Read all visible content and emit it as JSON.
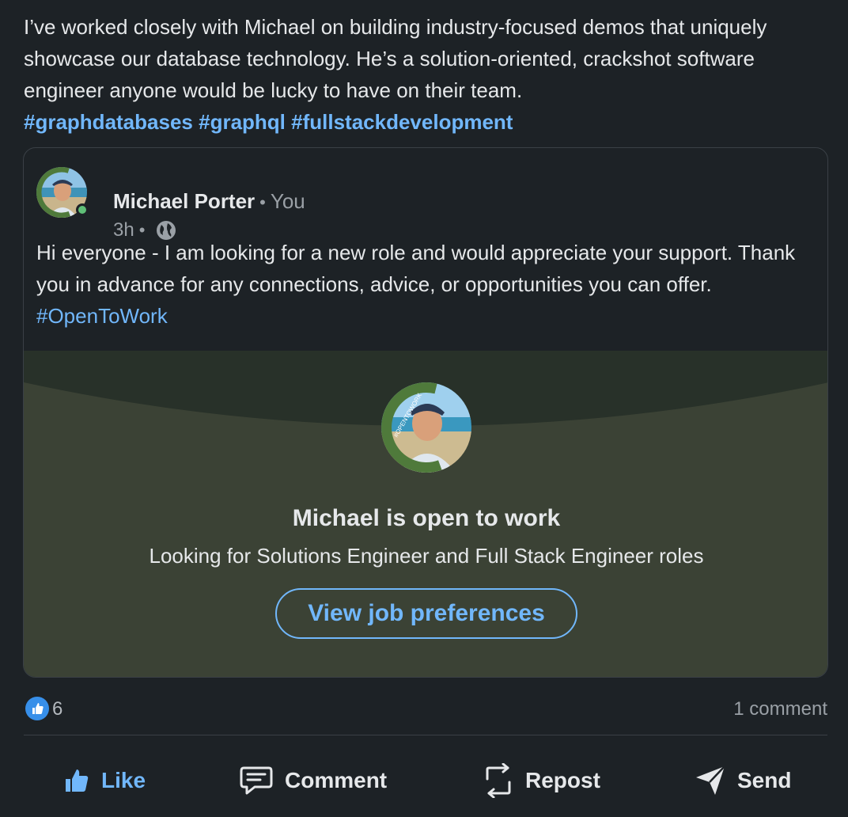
{
  "post": {
    "text": "I’ve worked closely with Michael on building industry-focused demos that uniquely showcase our database technology. He’s a solution-oriented, crackshot software engineer anyone would be lucky to have on their team.",
    "hashtags": [
      "#graphdatabases",
      "#graphql",
      "#fullstackdevelopment"
    ]
  },
  "shared": {
    "author_name": "Michael Porter",
    "relation": "You",
    "time": "3h",
    "text": "Hi everyone - I am looking for a new role and would appreciate your support. Thank you in advance for any connections, advice, or opportunities you can offer.",
    "hashtag": "#OpenToWork",
    "avatar_ring_text": "#OPENTOWORK",
    "otw": {
      "title": "Michael is open to work",
      "subtitle": "Looking for Solutions Engineer and Full Stack Engineer roles",
      "button": "View job preferences"
    }
  },
  "social": {
    "reactions": "6",
    "comments": "1 comment"
  },
  "actions": {
    "like": "Like",
    "comment": "Comment",
    "repost": "Repost",
    "send": "Send"
  },
  "colors": {
    "background": "#1d2226",
    "link": "#71b7fb",
    "otw_panel": "#3b4235",
    "otw_green": "#4f7a3b",
    "online": "#5fbf77"
  },
  "icons": [
    "globe-icon",
    "like-reaction-icon",
    "thumbs-up-icon",
    "comment-icon",
    "repost-icon",
    "send-icon"
  ]
}
